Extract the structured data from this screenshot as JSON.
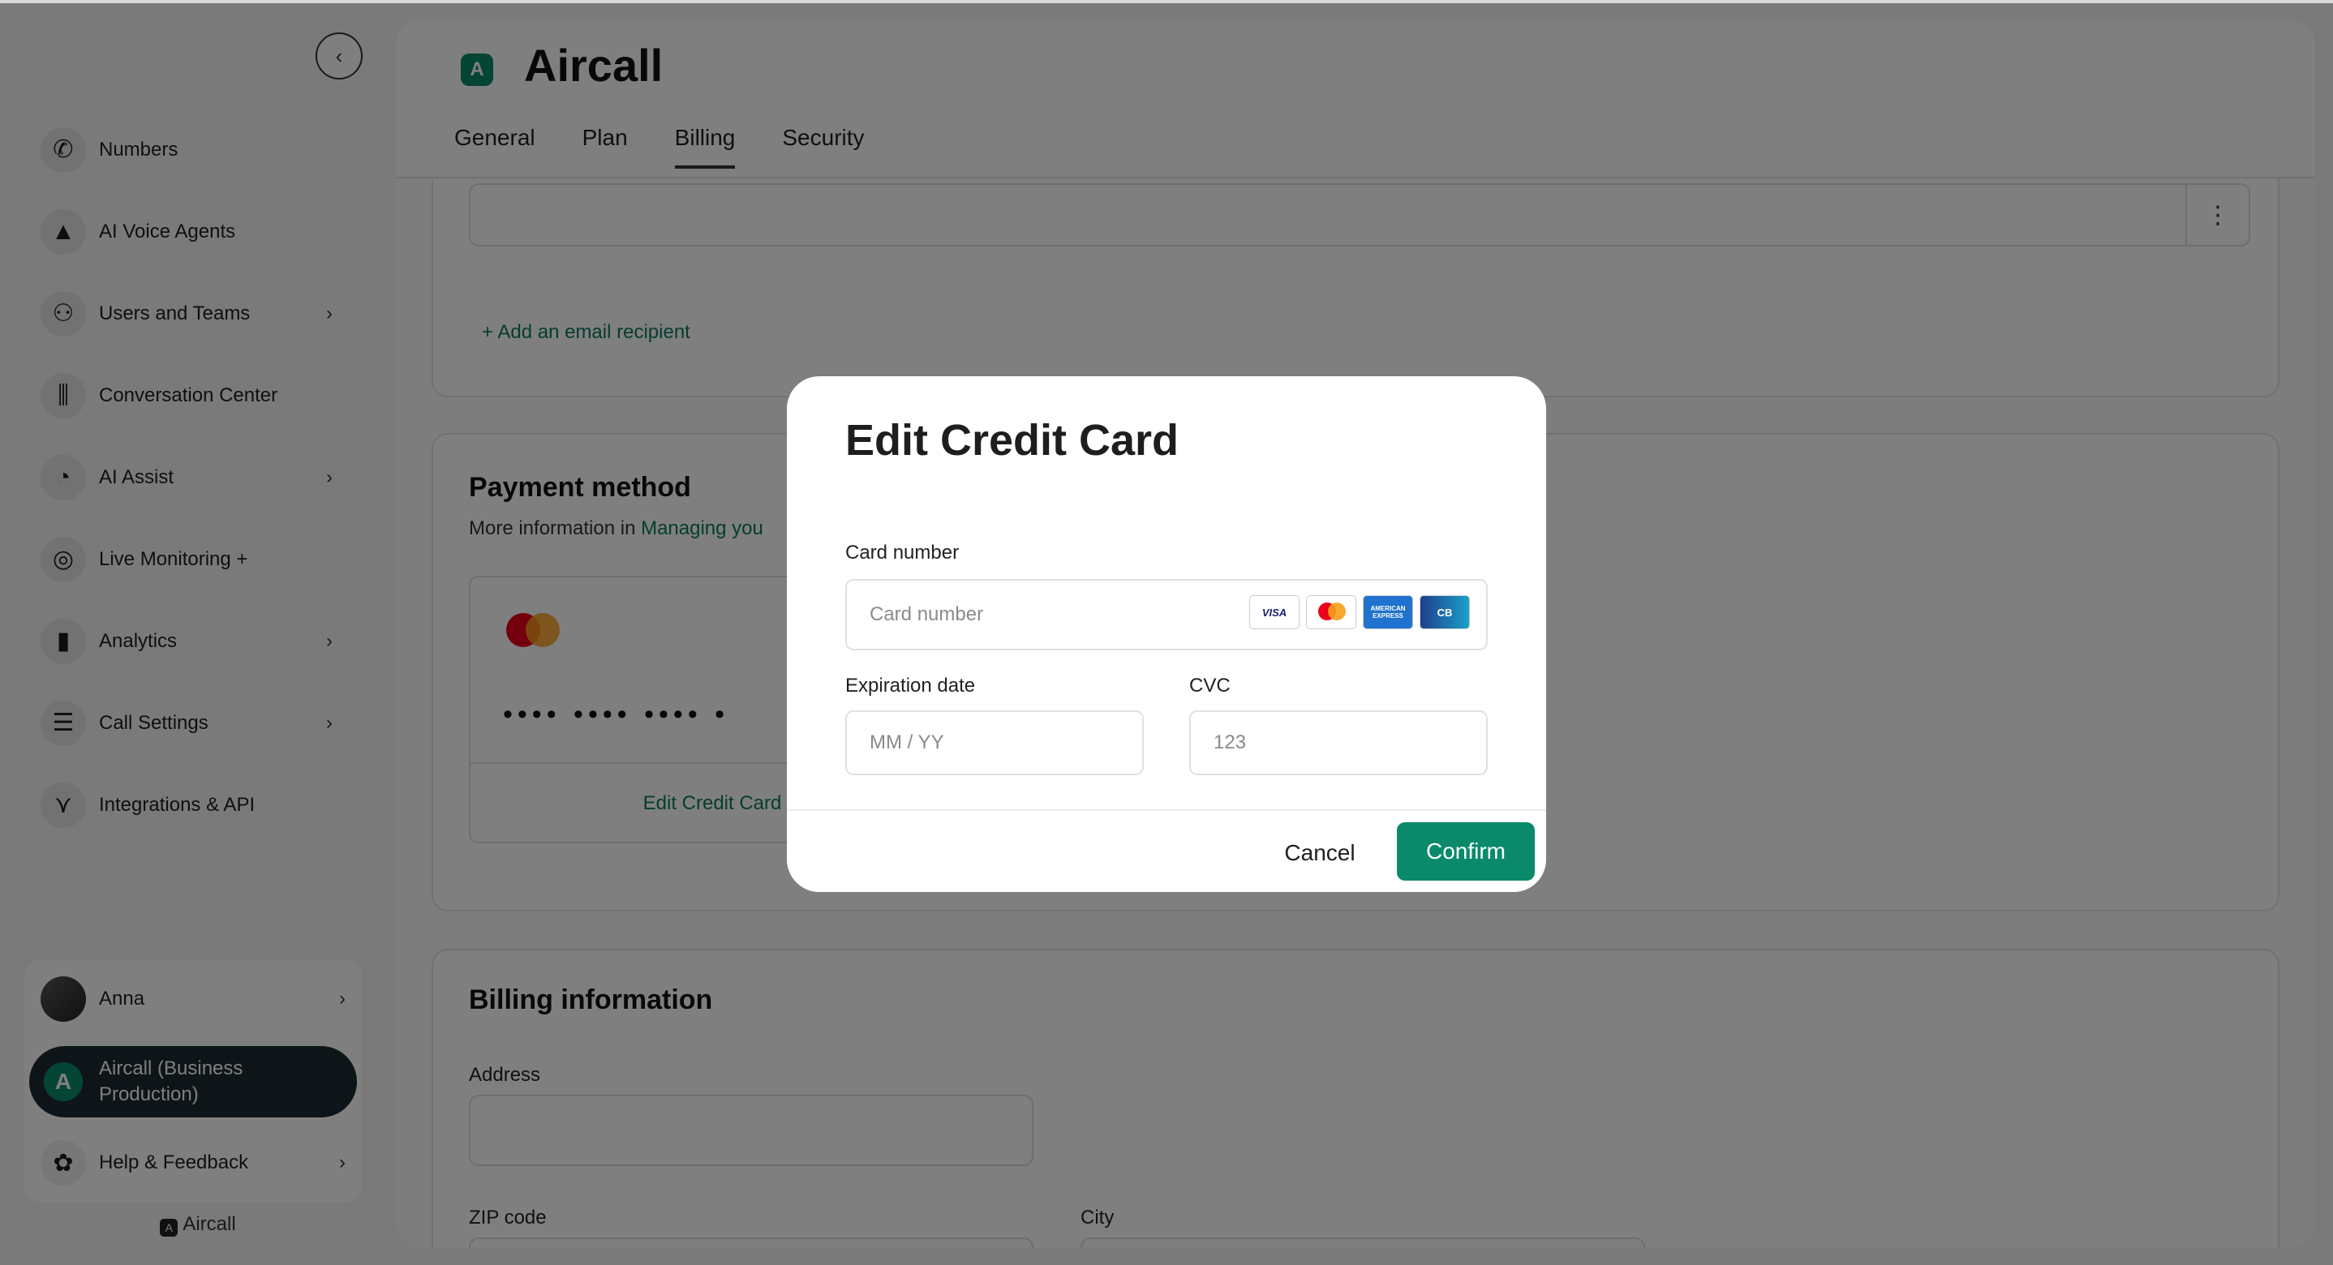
{
  "sidebar": {
    "collapse_glyph": "‹",
    "items": [
      {
        "label": "Numbers",
        "icon": "phone-icon",
        "glyph": "✆",
        "chevron": false
      },
      {
        "label": "AI Voice Agents",
        "icon": "ai-agent-icon",
        "glyph": "▲",
        "chevron": false
      },
      {
        "label": "Users and Teams",
        "icon": "users-icon",
        "glyph": "⚇",
        "chevron": true
      },
      {
        "label": "Conversation Center",
        "icon": "waveform-icon",
        "glyph": "⫼",
        "chevron": false
      },
      {
        "label": "AI Assist",
        "icon": "ai-assist-icon",
        "glyph": "◔",
        "chevron": true
      },
      {
        "label": "Live Monitoring +",
        "icon": "monitoring-icon",
        "glyph": "◎",
        "chevron": false
      },
      {
        "label": "Analytics",
        "icon": "analytics-icon",
        "glyph": "▮",
        "chevron": true
      },
      {
        "label": "Call Settings",
        "icon": "sliders-icon",
        "glyph": "☰",
        "chevron": true
      },
      {
        "label": "Integrations & API",
        "icon": "integrations-icon",
        "glyph": "⋎",
        "chevron": false
      }
    ],
    "chevron_glyph": "›",
    "user": {
      "name": "Anna"
    },
    "org": {
      "name_line1": "Aircall (Business",
      "name_line2": "Production)",
      "glyph": "A"
    },
    "help": {
      "label": "Help & Feedback",
      "glyph": "✿"
    },
    "footer_logo": "Aircall",
    "footer_glyph": "A"
  },
  "header": {
    "brand_glyph": "A",
    "title": "Aircall",
    "tabs": [
      "General",
      "Plan",
      "Billing",
      "Security"
    ],
    "active_tab": "Billing"
  },
  "invoices": {
    "add_recipient": "+ Add an email recipient",
    "menu_glyph": "⋮"
  },
  "payment": {
    "title": "Payment method",
    "info_prefix": "More information in",
    "info_link": "Managing you",
    "card_dots": "•••• •••• •••• •",
    "edit_link": "Edit Credit Card"
  },
  "billing": {
    "title": "Billing information",
    "address_label": "Address",
    "zip_label": "ZIP code",
    "city_label": "City"
  },
  "modal": {
    "title": "Edit Credit Card",
    "card_number_label": "Card number",
    "card_number_placeholder": "Card number",
    "expiration_label": "Expiration date",
    "expiration_placeholder": "MM / YY",
    "cvc_label": "CVC",
    "cvc_placeholder": "123",
    "cancel": "Cancel",
    "confirm": "Confirm",
    "brands": {
      "visa": "VISA",
      "amex": "AMERICAN EXPRESS",
      "cb": "CB"
    }
  },
  "colors": {
    "accent": "#0a8a6a",
    "dark_nav": "#1d2a33",
    "overlay": "rgba(0,0,0,0.5)"
  }
}
